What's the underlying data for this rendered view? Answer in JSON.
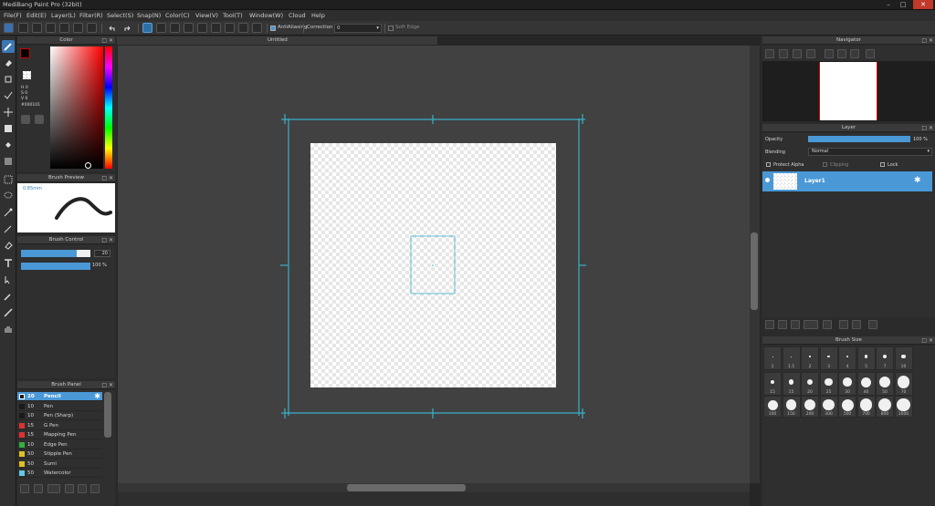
{
  "window": {
    "title": "MediBang Paint Pro (32bit)",
    "min": "–",
    "max": "□",
    "close": "✕"
  },
  "menu": [
    "File(F)",
    "Edit(E)",
    "Layer(L)",
    "Filter(R)",
    "Select(S)",
    "Snap(N)",
    "Color(C)",
    "View(V)",
    "Tool(T)",
    "Window(W)",
    "Cloud",
    "Help"
  ],
  "toolbar": {
    "antialiasing": "AntiAliasing",
    "correction_label": "Correction",
    "correction_value": "0",
    "soft_edge": "Soft Edge"
  },
  "color_panel": {
    "title": "Color",
    "h": "H 0",
    "s": "S 0",
    "v": "V 0",
    "hex": "#000101"
  },
  "brush_preview": {
    "title": "Brush Preview",
    "size": "0.85mm"
  },
  "brush_control": {
    "title": "Brush Control",
    "size": "20",
    "opacity": "100 %",
    "size_fraction": 0.8,
    "opacity_fraction": 1.0
  },
  "brush_panel": {
    "title": "Brush Panel",
    "items": [
      {
        "size": "20",
        "name": "Pencil",
        "color": "#1a1a1a",
        "selected": true
      },
      {
        "size": "10",
        "name": "Pen",
        "color": "#1a1a1a"
      },
      {
        "size": "10",
        "name": "Pen (Sharp)",
        "color": "#1a1a1a"
      },
      {
        "size": "15",
        "name": "G Pen",
        "color": "#e03030"
      },
      {
        "size": "15",
        "name": "Mapping Pen",
        "color": "#e03030"
      },
      {
        "size": "10",
        "name": "Edge Pen",
        "color": "#30b040"
      },
      {
        "size": "50",
        "name": "Stipple Pen",
        "color": "#e0c020"
      },
      {
        "size": "50",
        "name": "Sumi",
        "color": "#e0c020"
      },
      {
        "size": "50",
        "name": "Watercolor",
        "color": "#60c8e8"
      }
    ]
  },
  "document": {
    "tab": "Untitled"
  },
  "navigator": {
    "title": "Navigator"
  },
  "layer_panel": {
    "title": "Layer",
    "opacity_label": "Opacity",
    "opacity_value": "100 %",
    "opacity_fraction": 1.0,
    "blending_label": "Blending",
    "blending_value": "Normal",
    "protect_alpha": "Protect Alpha",
    "clipping": "Clipping",
    "lock": "Lock",
    "layer_name": "Layer1"
  },
  "brush_size": {
    "title": "Brush Size",
    "rows": [
      [
        "1",
        "1.5",
        "2",
        "3",
        "4",
        "5",
        "7",
        "10"
      ],
      [
        "15",
        "15",
        "20",
        "25",
        "30",
        "40",
        "50",
        "70"
      ],
      [
        "100",
        "150",
        "200",
        "300",
        "500",
        "700",
        "800",
        "1000"
      ]
    ]
  },
  "colors": {
    "accent": "#4a98d6",
    "guide": "#3ab0c8"
  }
}
